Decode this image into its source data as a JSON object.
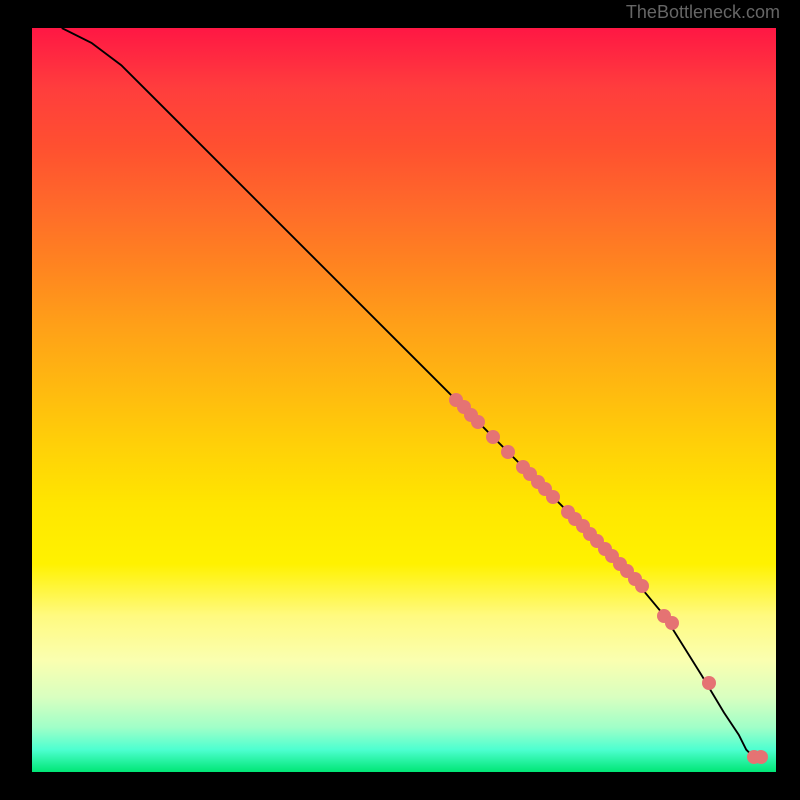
{
  "watermark": "TheBottleneck.com",
  "chart_data": {
    "type": "line",
    "title": "",
    "xlabel": "",
    "ylabel": "",
    "xlim": [
      0,
      100
    ],
    "ylim": [
      0,
      100
    ],
    "series": [
      {
        "name": "curve",
        "x": [
          4,
          8,
          12,
          16,
          20,
          30,
          40,
          50,
          60,
          70,
          80,
          85,
          90,
          93,
          95,
          96,
          97,
          97.5,
          98
        ],
        "y": [
          100,
          98,
          95,
          91,
          87,
          77,
          67,
          57,
          47,
          37,
          27,
          21,
          13,
          8,
          5,
          3,
          2,
          1.5,
          2
        ]
      }
    ],
    "points": {
      "name": "highlighted-dots",
      "color": "#e57373",
      "x": [
        57,
        58,
        59,
        60,
        62,
        64,
        66,
        67,
        68,
        69,
        70,
        72,
        73,
        74,
        75,
        76,
        77,
        78,
        79,
        80,
        81,
        82,
        85,
        86,
        91,
        97,
        98
      ],
      "y": [
        50,
        49,
        48,
        47,
        45,
        43,
        41,
        40,
        39,
        38,
        37,
        35,
        34,
        33,
        32,
        31,
        30,
        29,
        28,
        27,
        26,
        25,
        21,
        20,
        12,
        2,
        2
      ]
    }
  }
}
